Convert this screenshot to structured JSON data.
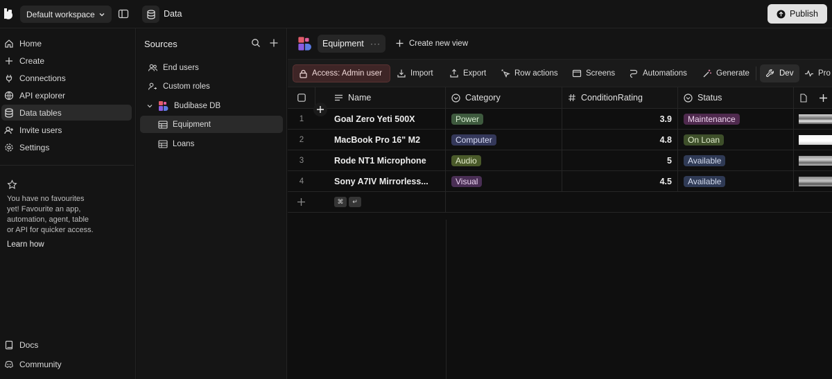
{
  "workspace": {
    "name": "Default workspace"
  },
  "breadcrumb": {
    "title": "Data"
  },
  "publish": {
    "label": "Publish"
  },
  "nav": {
    "items": [
      {
        "label": "Home",
        "icon": "home-icon"
      },
      {
        "label": "Create",
        "icon": "plus-icon"
      },
      {
        "label": "Connections",
        "icon": "connections-icon"
      },
      {
        "label": "API explorer",
        "icon": "globe-icon"
      },
      {
        "label": "Data tables",
        "icon": "database-icon",
        "active": true
      },
      {
        "label": "Invite users",
        "icon": "user-plus-icon"
      },
      {
        "label": "Settings",
        "icon": "gear-icon"
      }
    ],
    "favourites_text": "You have no favourites yet! Favourite an app, automation, agent, table or API for quicker access.",
    "learn_how": "Learn how",
    "bottom": [
      {
        "label": "Docs",
        "icon": "book-icon"
      },
      {
        "label": "Community",
        "icon": "discord-icon"
      }
    ]
  },
  "sources": {
    "title": "Sources",
    "items": [
      {
        "label": "End users",
        "icon": "users-icon"
      },
      {
        "label": "Custom roles",
        "icon": "user-key-icon"
      },
      {
        "label": "Budibase DB",
        "icon": "budibase-icon"
      },
      {
        "label": "Equipment",
        "icon": "table-icon",
        "active": true
      },
      {
        "label": "Loans",
        "icon": "table-icon"
      }
    ]
  },
  "view": {
    "tab_label": "Equipment",
    "create_view": "Create new view"
  },
  "toolbar": {
    "access": "Access: Admin user",
    "import": "Import",
    "export": "Export",
    "row_actions": "Row actions",
    "screens": "Screens",
    "automations": "Automations",
    "generate": "Generate",
    "dev": "Dev",
    "prod": "Pro"
  },
  "table": {
    "columns": [
      "Name",
      "Category",
      "ConditionRating",
      "Status"
    ],
    "rows": [
      {
        "num": "1",
        "name": "Goal Zero Yeti 500X",
        "category": "Power",
        "rating": "3.9",
        "status": "Maintenance"
      },
      {
        "num": "2",
        "name": "MacBook Pro 16\" M2",
        "category": "Computer",
        "rating": "4.8",
        "status": "On Loan"
      },
      {
        "num": "3",
        "name": "Rode NT1 Microphone",
        "category": "Audio",
        "rating": "5",
        "status": "Available"
      },
      {
        "num": "4",
        "name": "Sony A7IV Mirrorless...",
        "category": "Visual",
        "rating": "4.5",
        "status": "Available"
      }
    ],
    "kbd_cmd": "⌘",
    "kbd_enter": "↵"
  },
  "colors": {
    "tag_power": "#3f5a3a",
    "tag_computer": "#34385a",
    "tag_audio": "#4a5a2a",
    "tag_visual": "#4a2f55",
    "status_maintenance": "#4f2a4e",
    "status_onloan": "#3e4f2a",
    "status_available": "#2f3a55"
  }
}
